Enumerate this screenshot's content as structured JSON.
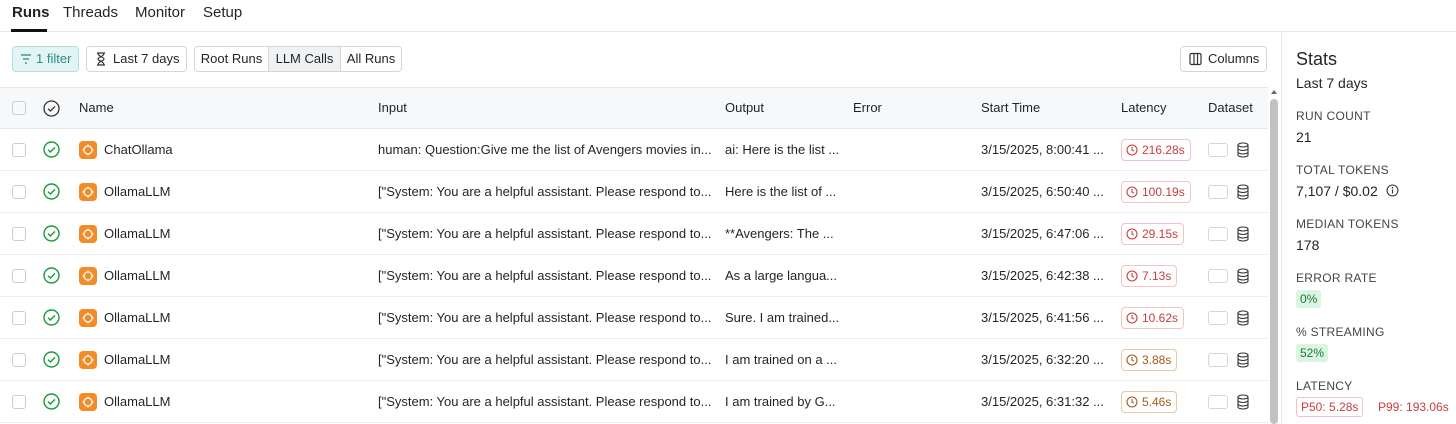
{
  "nav": {
    "tabs": [
      "Runs",
      "Threads",
      "Monitor",
      "Setup"
    ]
  },
  "toolbar": {
    "filter_label": "1 filter",
    "time_label": "Last 7 days",
    "segments": [
      "Root Runs",
      "LLM Calls",
      "All Runs"
    ],
    "columns_label": "Columns"
  },
  "table": {
    "headers": [
      "Name",
      "Input",
      "Output",
      "Error",
      "Start Time",
      "Latency",
      "Dataset"
    ],
    "rows": [
      {
        "name": "ChatOllama",
        "input": "human: Question:Give me the list of Avengers movies in...",
        "output": "ai: Here is the list ...",
        "error": "",
        "start": "3/15/2025, 8:00:41 ...",
        "latency": "216.28s",
        "level": "high"
      },
      {
        "name": "OllamaLLM",
        "input": "[\"System: You are a helpful assistant. Please respond to...",
        "output": "Here is the list of ...",
        "error": "",
        "start": "3/15/2025, 6:50:40 ...",
        "latency": "100.19s",
        "level": "high"
      },
      {
        "name": "OllamaLLM",
        "input": "[\"System: You are a helpful assistant. Please respond to...",
        "output": "**Avengers: The ...",
        "error": "",
        "start": "3/15/2025, 6:47:06 ...",
        "latency": "29.15s",
        "level": "high"
      },
      {
        "name": "OllamaLLM",
        "input": "[\"System: You are a helpful assistant. Please respond to...",
        "output": "As a large langua...",
        "error": "",
        "start": "3/15/2025, 6:42:38 ...",
        "latency": "7.13s",
        "level": "high"
      },
      {
        "name": "OllamaLLM",
        "input": "[\"System: You are a helpful assistant. Please respond to...",
        "output": "Sure. I am trained...",
        "error": "",
        "start": "3/15/2025, 6:41:56 ...",
        "latency": "10.62s",
        "level": "high"
      },
      {
        "name": "OllamaLLM",
        "input": "[\"System: You are a helpful assistant. Please respond to...",
        "output": "I am trained on a ...",
        "error": "",
        "start": "3/15/2025, 6:32:20 ...",
        "latency": "3.88s",
        "level": "medium"
      },
      {
        "name": "OllamaLLM",
        "input": "[\"System: You are a helpful assistant. Please respond to...",
        "output": "I am trained by G...",
        "error": "",
        "start": "3/15/2025, 6:31:32 ...",
        "latency": "5.46s",
        "level": "medium"
      }
    ]
  },
  "stats": {
    "title": "Stats",
    "period": "Last 7 days",
    "run_count_label": "RUN COUNT",
    "run_count": "21",
    "total_tokens_label": "TOTAL TOKENS",
    "total_tokens": "7,107 / $0.02",
    "median_tokens_label": "MEDIAN TOKENS",
    "median_tokens": "178",
    "error_rate_label": "ERROR RATE",
    "error_rate": "0%",
    "streaming_label": "% STREAMING",
    "streaming": "52%",
    "latency_label": "LATENCY",
    "p50": "P50: 5.28s",
    "p99": "P99: 193.06s"
  },
  "colors": {
    "accent": "#2c8b8b",
    "run_icon": "#f28c28",
    "success": "#1a9a3c",
    "latency_high": "#c93d3d",
    "latency_medium": "#a35a1b"
  }
}
